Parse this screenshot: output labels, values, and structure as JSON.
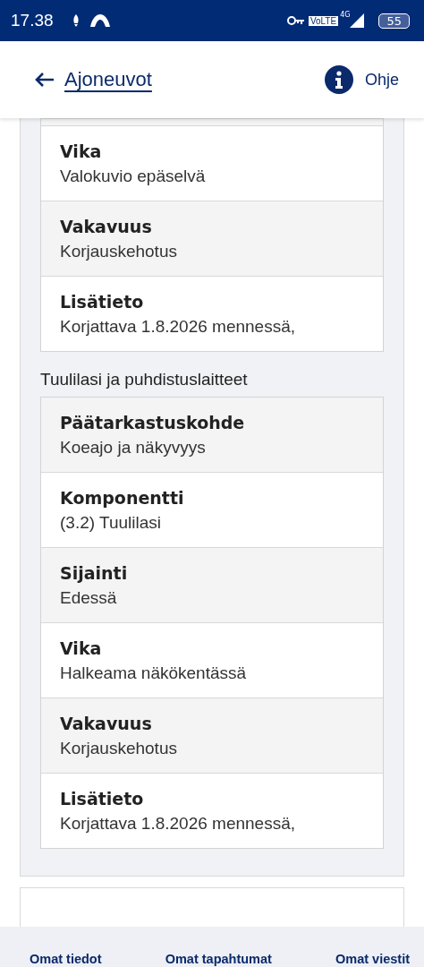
{
  "status_bar": {
    "time": "17.38",
    "volte": "VoLTE",
    "network": "4G",
    "battery": "55"
  },
  "header": {
    "back_link": "Ajoneuvot",
    "help": "Ohje"
  },
  "groups": [
    {
      "partial_top": true,
      "rows": [
        {
          "label": "Vika",
          "value": "Valokuvio epäselvä"
        },
        {
          "label": "Vakavuus",
          "value": "Korjauskehotus"
        },
        {
          "label": "Lisätieto",
          "value": "Korjattava 1.8.2026 mennessä,"
        }
      ]
    },
    {
      "title": "Tuulilasi ja puhdistuslaitteet",
      "partial_top": false,
      "rows": [
        {
          "label": "Päätarkastuskohde",
          "value": "Koeajo ja näkyvyys"
        },
        {
          "label": "Komponentti",
          "value": "(3.2) Tuulilasi"
        },
        {
          "label": "Sijainti",
          "value": "Edessä"
        },
        {
          "label": "Vika",
          "value": "Halkeama näkökentässä"
        },
        {
          "label": "Vakavuus",
          "value": "Korjauskehotus"
        },
        {
          "label": "Lisätieto",
          "value": "Korjattava 1.8.2026 mennessä,"
        }
      ]
    }
  ],
  "bottom_nav": [
    {
      "label": "Omat tiedot"
    },
    {
      "label": "Omat tapahtumat"
    },
    {
      "label": "Omat viestit"
    }
  ]
}
